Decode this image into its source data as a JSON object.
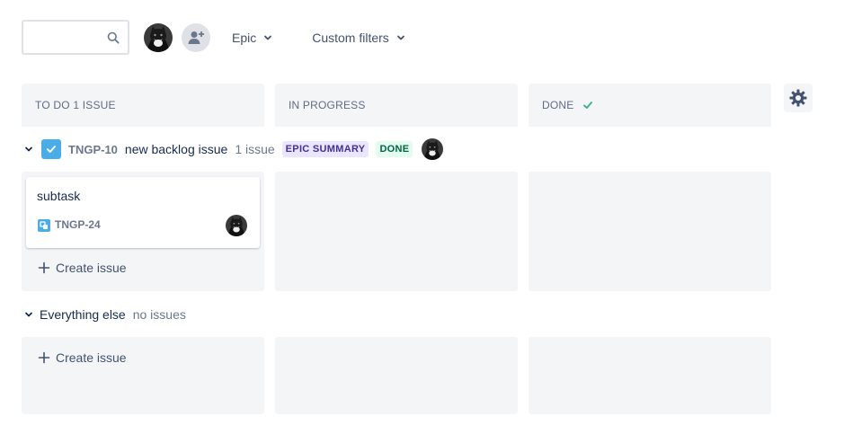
{
  "toolbar": {
    "search_value": "",
    "search_placeholder": "",
    "epic_label": "Epic",
    "custom_filters_label": "Custom filters"
  },
  "columns": [
    {
      "label": "TO DO 1 ISSUE"
    },
    {
      "label": "IN PROGRESS"
    },
    {
      "label": "DONE"
    }
  ],
  "swimlanes": {
    "epic": {
      "key": "TNGP-10",
      "title": "new backlog issue",
      "count": "1 issue",
      "badge_summary": "EPIC SUMMARY",
      "badge_status": "DONE"
    },
    "other": {
      "title": "Everything else",
      "count": "no issues"
    }
  },
  "card": {
    "title": "subtask",
    "key": "TNGP-24"
  },
  "create_issue_label": "Create issue",
  "colors": {
    "column_bg": "#f4f5f7",
    "epic_badge_bg": "#eae6ff",
    "done_badge_bg": "#e3fcef",
    "check_green": "#36b37e",
    "epic_icon_blue": "#4bade8"
  }
}
